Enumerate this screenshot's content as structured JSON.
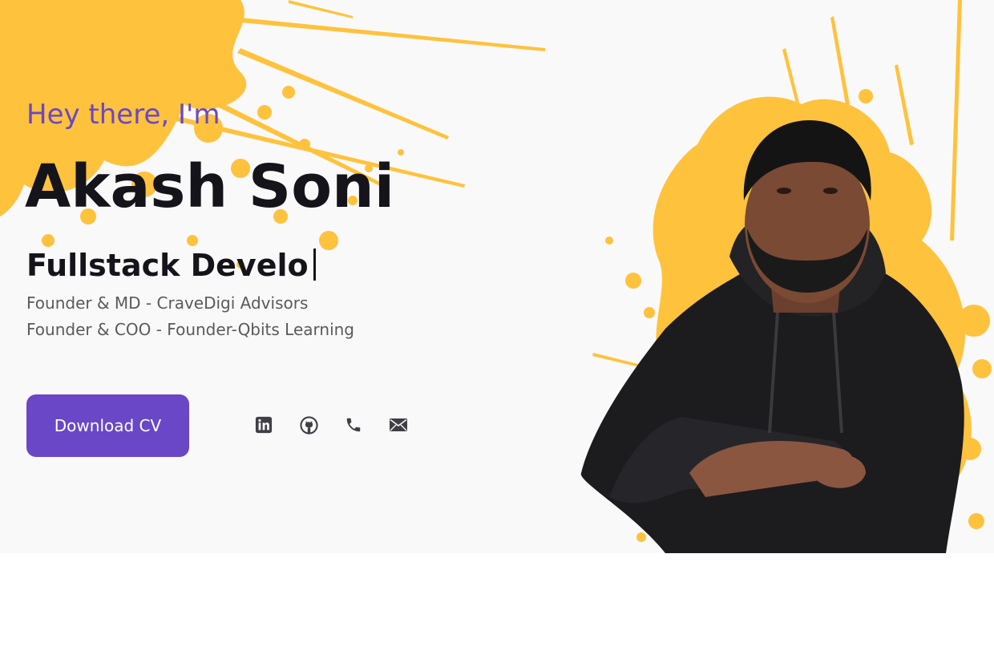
{
  "hero": {
    "greeting": "Hey there, I'm",
    "name": "Akash Soni",
    "typed_role": "Fullstack Develo",
    "positions": [
      "Founder & MD - CraveDigi Advisors",
      "Founder & COO - Founder-Qbits Learning"
    ],
    "cv_button": "Download CV"
  },
  "socials": [
    {
      "icon": "linkedin-icon"
    },
    {
      "icon": "github-icon"
    },
    {
      "icon": "phone-icon"
    },
    {
      "icon": "mail-icon"
    }
  ],
  "colors": {
    "accent": "#6a47c7",
    "splash": "#ffc23d",
    "background": "#f9f9f9",
    "heading": "#14141a",
    "body_text": "#5a5a5a",
    "icon": "#3f3f46"
  }
}
